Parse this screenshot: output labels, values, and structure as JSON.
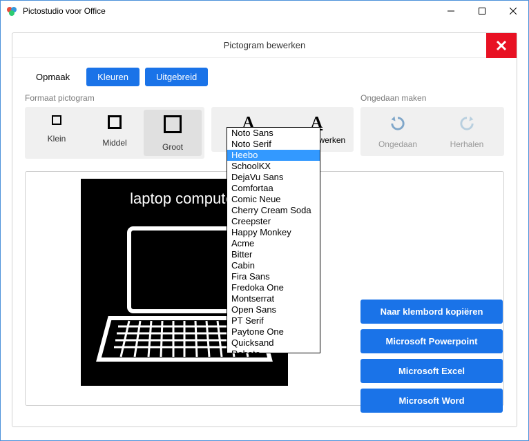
{
  "window": {
    "title": "Pictostudio voor Office"
  },
  "panel": {
    "title": "Pictogram bewerken"
  },
  "tabs": {
    "opmaak": "Opmaak",
    "kleuren": "Kleuren",
    "uitgebreid": "Uitgebreid"
  },
  "format": {
    "label": "Formaat pictogram",
    "klein": "Klein",
    "middel": "Middel",
    "groot": "Groot"
  },
  "text": {
    "bewerken": "Tekst bewerken"
  },
  "undo": {
    "label": "Ongedaan maken",
    "ongedaan": "Ongedaan",
    "herhalen": "Herhalen"
  },
  "preview": {
    "text": "laptop computer",
    "status": "Groot"
  },
  "actions": {
    "clipboard": "Naar klembord kopiëren",
    "powerpoint": "Microsoft Powerpoint",
    "excel": "Microsoft Excel",
    "word": "Microsoft Word"
  },
  "fonts": {
    "selected_index": 2,
    "items": [
      "Noto Sans",
      "Noto Serif",
      "Heebo",
      "SchoolKX",
      "DejaVu Sans",
      "Comfortaa",
      "Comic Neue",
      "Cherry Cream Soda",
      "Creepster",
      "Happy Monkey",
      "Acme",
      "Bitter",
      "Cabin",
      "Fira Sans",
      "Fredoka One",
      "Montserrat",
      "Open Sans",
      "PT Serif",
      "Paytone One",
      "Quicksand",
      "Roboto"
    ]
  }
}
